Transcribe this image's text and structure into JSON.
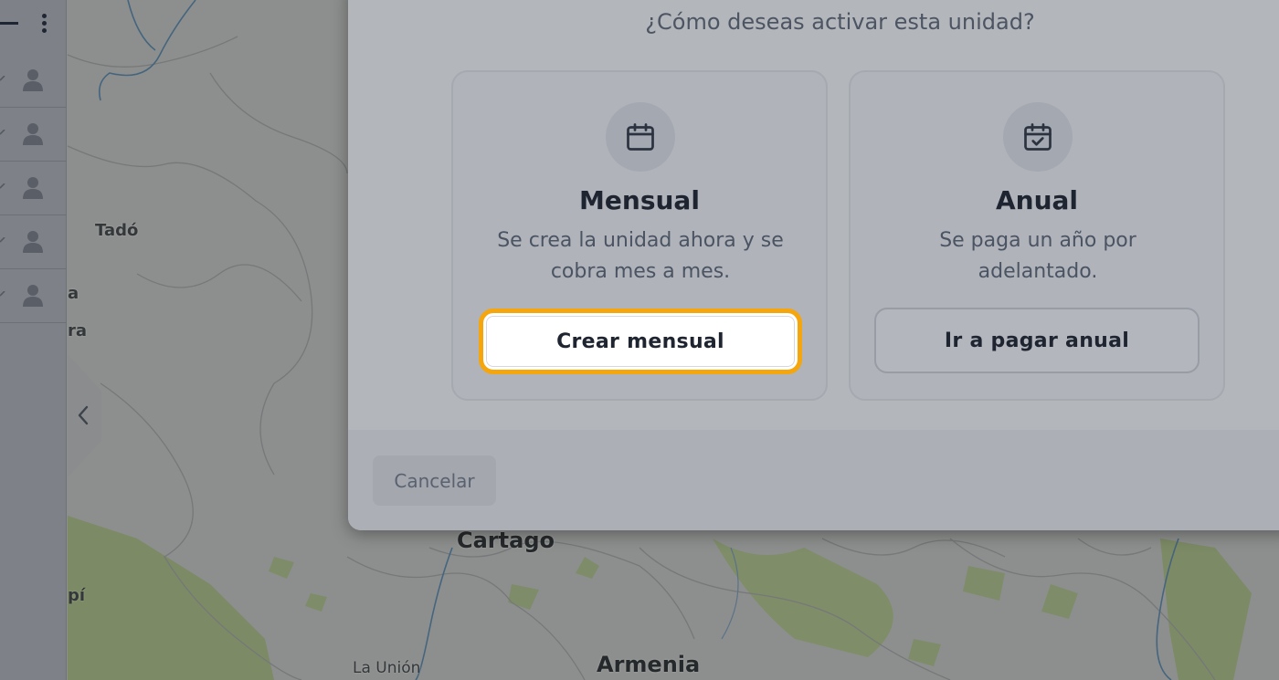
{
  "map": {
    "places": [
      "Tadó",
      "Cartago",
      "Armenia",
      "La Unión",
      "a",
      "ra",
      "pí"
    ],
    "colors": {
      "land": "#8d8f8e",
      "forest": "#7c8a65",
      "river": "#45657e",
      "border": "#767879"
    }
  },
  "sidebar": {
    "menu_icon": "kebab-vertical-icon",
    "rows": [
      {
        "icon": "user-icon"
      },
      {
        "icon": "user-icon"
      },
      {
        "icon": "user-icon"
      },
      {
        "icon": "user-icon"
      },
      {
        "icon": "user-icon"
      }
    ],
    "collapse_icon": "chevron-left-icon"
  },
  "modal": {
    "question": "¿Cómo deseas activar esta unidad?",
    "options": [
      {
        "icon": "calendar-icon",
        "title": "Mensual",
        "description": "Se crea la unidad ahora y se cobra mes a mes.",
        "button": "Crear mensual",
        "focused": true
      },
      {
        "icon": "calendar-check-icon",
        "title": "Anual",
        "description": "Se paga un año por adelantado.",
        "button": "Ir a pagar anual",
        "focused": false
      }
    ],
    "cancel_label": "Cancelar"
  },
  "colors": {
    "focus_ring": "#f5a60c",
    "text_dark": "#1e2430",
    "text_muted": "#4b5462"
  }
}
